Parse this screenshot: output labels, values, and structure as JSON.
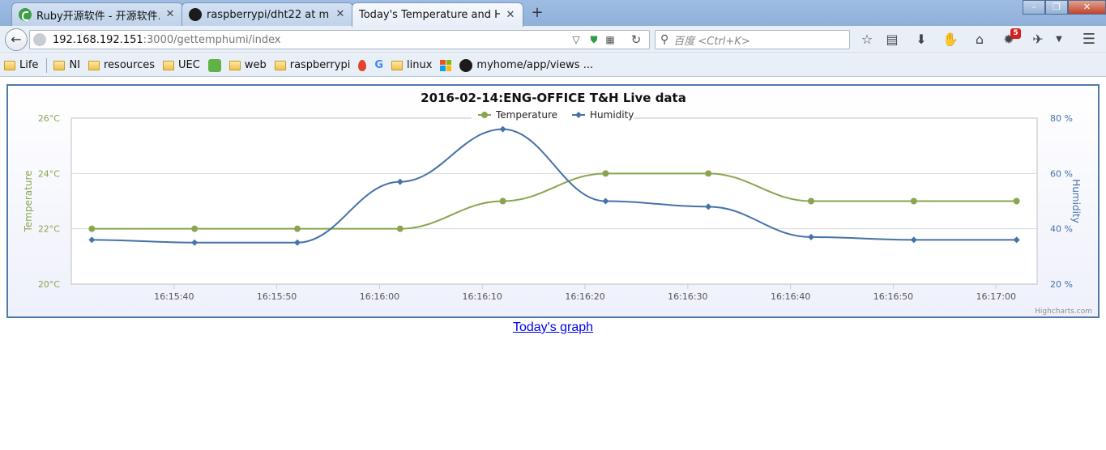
{
  "window": {
    "tabs": [
      {
        "title": "Ruby开源软件 - 开源软件...",
        "icon": "ruby-china-icon"
      },
      {
        "title": "raspberrypi/dht22 at ma...",
        "icon": "github-icon"
      },
      {
        "title": "Today's Temperature and H...",
        "icon": "none",
        "active": true
      }
    ],
    "new_tab": "+"
  },
  "nav": {
    "url_host": "192.168.192.151",
    "url_path": ":3000/gettemphumi/index",
    "search_placeholder": "百度 <Ctrl+K>",
    "notification_count": "5"
  },
  "bookmarks": [
    {
      "label": "Life",
      "icon": "folder-icon"
    },
    {
      "label": "NI",
      "icon": "folder-icon"
    },
    {
      "label": "resources",
      "icon": "folder-icon"
    },
    {
      "label": "UEC",
      "icon": "folder-icon"
    },
    {
      "label": "",
      "icon": "evernote-icon"
    },
    {
      "label": "web",
      "icon": "folder-icon"
    },
    {
      "label": "raspberrypi",
      "icon": "folder-icon"
    },
    {
      "label": "",
      "icon": "flame-icon"
    },
    {
      "label": "G",
      "icon": "google-icon"
    },
    {
      "label": "linux",
      "icon": "folder-icon"
    },
    {
      "label": "",
      "icon": "microsoft-icon"
    },
    {
      "label": "myhome/app/views ...",
      "icon": "github-icon"
    }
  ],
  "chart_data": {
    "type": "line",
    "title": "2016-02-14:ENG-OFFICE T&H Live data",
    "credits": "Highcharts.com",
    "legend_position": "top-center",
    "x_ticks": [
      "16:15:40",
      "16:15:50",
      "16:16:00",
      "16:16:10",
      "16:16:20",
      "16:16:30",
      "16:16:40",
      "16:16:50",
      "16:17:00"
    ],
    "x_range_seconds_after_16_15": [
      31,
      60,
      152
    ],
    "x": [
      "16:15:32",
      "16:15:42",
      "16:15:52",
      "16:16:02",
      "16:16:12",
      "16:16:22",
      "16:16:32",
      "16:16:42",
      "16:16:52",
      "16:17:02"
    ],
    "series": [
      {
        "name": "Temperature",
        "axis": "left",
        "color": "#89a54e",
        "marker": "circle",
        "values": [
          22,
          22,
          22,
          22,
          23,
          24,
          24,
          23,
          23,
          23
        ]
      },
      {
        "name": "Humidity",
        "axis": "right",
        "color": "#4572a7",
        "marker": "diamond",
        "values": [
          36,
          35,
          35,
          57,
          76,
          50,
          48,
          37,
          36,
          36
        ]
      }
    ],
    "y_left": {
      "label": "Temperature",
      "ticks": [
        "20°C",
        "22°C",
        "24°C",
        "26°C"
      ],
      "min": 20,
      "max": 26
    },
    "y_right": {
      "label": "Humidity",
      "ticks": [
        "20 %",
        "40 %",
        "60 %",
        "80 %"
      ],
      "min": 20,
      "max": 80
    },
    "grid": true
  },
  "link": {
    "label": "Today's graph"
  }
}
